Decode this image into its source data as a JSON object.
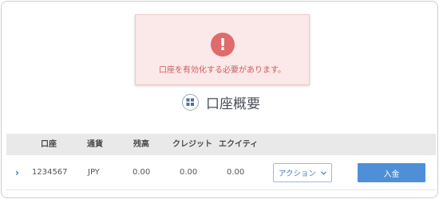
{
  "alert": {
    "icon": "exclamation-icon",
    "icon_glyph": "!",
    "message": "口座を有効化する必要があります。"
  },
  "section": {
    "icon": "grid-icon",
    "title": "口座概要"
  },
  "table": {
    "headers": [
      "口座",
      "通貨",
      "残高",
      "クレジット",
      "エクイティ"
    ],
    "rows": [
      {
        "expand_icon": "chevron-right-icon",
        "expand_glyph": "›",
        "account": "1234567",
        "currency": "JPY",
        "balance": "0.00",
        "credit": "0.00",
        "equity": "0.00",
        "action_label": "アクション",
        "action_chevron": "chevron-down-icon",
        "deposit_label": "入金"
      }
    ]
  },
  "colors": {
    "alert_bg": "#fbe8e8",
    "alert_accent": "#df6b6b",
    "primary": "#4f8fd8",
    "header_bg": "#e9e9e9"
  }
}
